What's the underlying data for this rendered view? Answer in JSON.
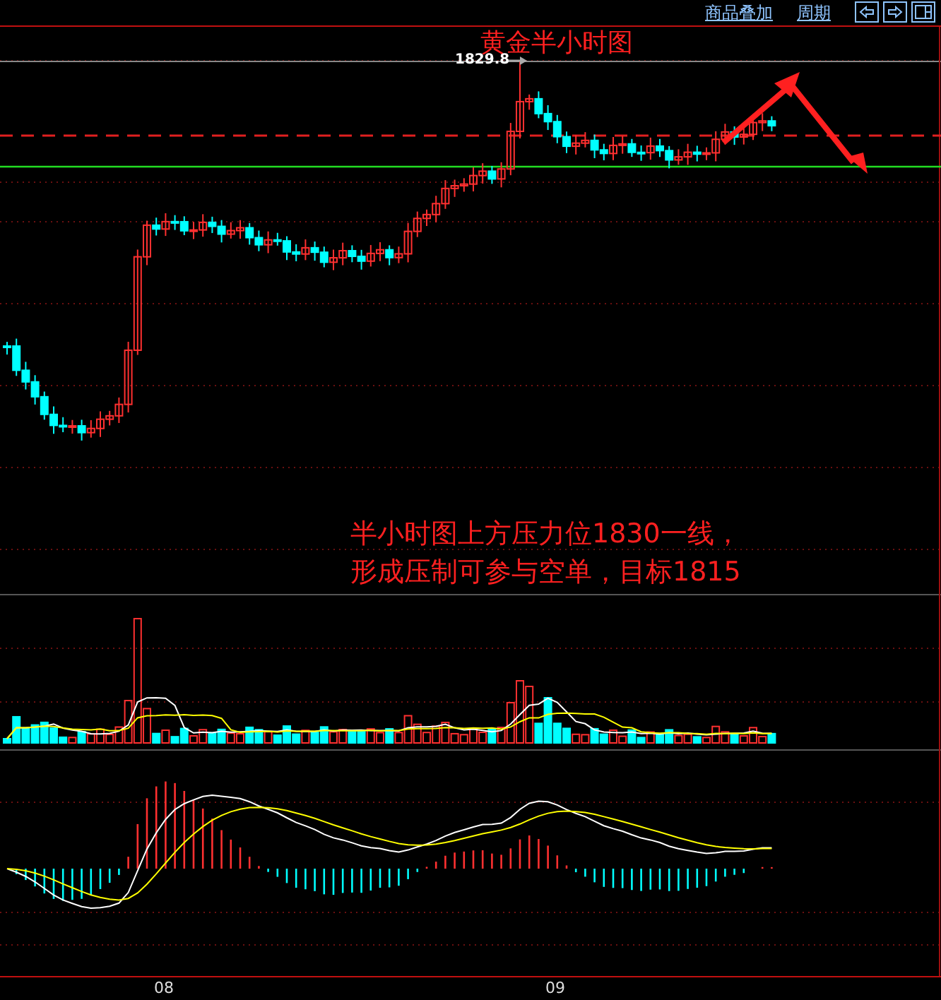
{
  "toolbar": {
    "links": [
      "商品叠加",
      "周期"
    ]
  },
  "chart": {
    "title": "黄金半小时图",
    "price_label": "1829.8",
    "annotation": [
      "半小时图上方压力位1830一线，",
      "形成压制可参与空单，目标1815"
    ],
    "x_labels": [
      "08",
      "09"
    ]
  }
}
